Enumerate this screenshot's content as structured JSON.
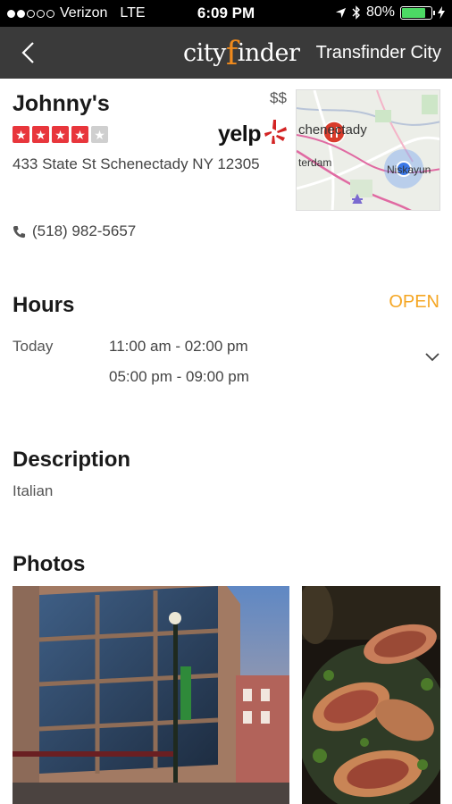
{
  "status_bar": {
    "carrier": "Verizon",
    "network": "LTE",
    "time": "6:09 PM",
    "battery": "80%",
    "battery_level": 0.8
  },
  "nav": {
    "logo_part1": "city",
    "logo_f": "f",
    "logo_part2": "inder",
    "right_label": "Transfinder City"
  },
  "restaurant": {
    "name": "Johnny's",
    "price": "$$",
    "rating": 4,
    "rating_max": 5,
    "review_source": "yelp",
    "address": "433 State St Schenectady NY 12305",
    "phone": "(518) 982-5657"
  },
  "map": {
    "label_city": "chenectady",
    "label_left": "terdam",
    "label_right": "Niskayun"
  },
  "hours": {
    "title": "Hours",
    "status": "OPEN",
    "day": "Today",
    "ranges": [
      "11:00 am - 02:00 pm",
      "05:00 pm - 09:00 pm"
    ]
  },
  "description": {
    "title": "Description",
    "text": "Italian"
  },
  "photos": {
    "title": "Photos"
  },
  "colors": {
    "accent": "#f08a1c",
    "open": "#f5a623",
    "yelp_red": "#d32323",
    "star_red": "#e8363c",
    "nav_bg": "#3a3a3a"
  }
}
